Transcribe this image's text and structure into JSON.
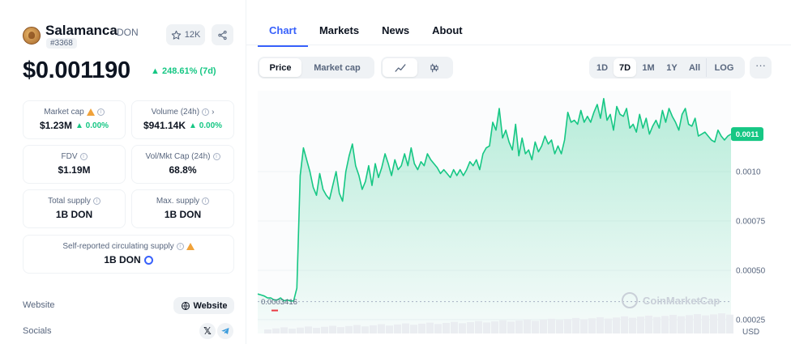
{
  "coin": {
    "name": "Salamanca",
    "symbol": "DON",
    "rank": "#3368",
    "watchlist_count": "12K",
    "price": "$0.001190",
    "price_change": "248.61% (7d)"
  },
  "stats": {
    "market_cap": {
      "label": "Market cap",
      "value": "$1.23M",
      "change": "0.00%"
    },
    "volume": {
      "label": "Volume (24h)",
      "value": "$941.14K",
      "change": "0.00%"
    },
    "fdv": {
      "label": "FDV",
      "value": "$1.19M"
    },
    "vol_mkt_cap": {
      "label": "Vol/Mkt Cap (24h)",
      "value": "68.8%"
    },
    "total_supply": {
      "label": "Total supply",
      "value": "1B DON"
    },
    "max_supply": {
      "label": "Max. supply",
      "value": "1B DON"
    },
    "circ_supply": {
      "label": "Self-reported circulating supply",
      "value": "1B DON"
    }
  },
  "links": {
    "website_label": "Website",
    "website_button": "Website",
    "socials_label": "Socials"
  },
  "tabs": [
    "Chart",
    "Markets",
    "News",
    "About"
  ],
  "chart_toggle": [
    "Price",
    "Market cap"
  ],
  "ranges": [
    "1D",
    "7D",
    "1M",
    "1Y",
    "All",
    "LOG"
  ],
  "active_range": "7D",
  "colors": {
    "positive": "#16c784",
    "accent": "#3861fb",
    "line": "#16c784",
    "marker_low": "#ea3943"
  },
  "chart_data": {
    "type": "area",
    "currency_label": "USD",
    "watermark": "CoinMarketCap",
    "current_price_label": "0.0011",
    "start_price_label": "0.0003416",
    "start_price": 0.0003416,
    "ylim": [
      0.00018,
      0.00141
    ],
    "ticks": [
      {
        "value": 0.001,
        "label": "0.0010"
      },
      {
        "value": 0.00075,
        "label": "0.00075"
      },
      {
        "value": 0.0005,
        "label": "0.00050"
      },
      {
        "value": 0.00025,
        "label": "0.00025"
      }
    ],
    "values": [
      0.00038,
      0.000375,
      0.00037,
      0.00036,
      0.00036,
      0.00035,
      0.00035,
      0.00036,
      0.000345,
      0.00035,
      0.000345,
      0.000345,
      0.00041,
      0.00098,
      0.00112,
      0.00106,
      0.001,
      0.00092,
      0.00088,
      0.00099,
      0.00091,
      0.00088,
      0.00086,
      0.00093,
      0.001,
      0.00089,
      0.00085,
      0.001,
      0.00108,
      0.00114,
      0.00103,
      0.00098,
      0.00091,
      0.00095,
      0.00103,
      0.00093,
      0.00104,
      0.00097,
      0.00102,
      0.00109,
      0.00104,
      0.00098,
      0.00106,
      0.00101,
      0.00103,
      0.00109,
      0.00103,
      0.00112,
      0.00104,
      0.00101,
      0.00105,
      0.00103,
      0.00109,
      0.00106,
      0.00104,
      0.00102,
      0.00099,
      0.00101,
      0.00099,
      0.00097,
      0.00101,
      0.00098,
      0.00101,
      0.00098,
      0.00101,
      0.00105,
      0.00103,
      0.00106,
      0.00101,
      0.00109,
      0.00112,
      0.00113,
      0.00125,
      0.00121,
      0.00132,
      0.00117,
      0.00121,
      0.00115,
      0.00111,
      0.00124,
      0.00108,
      0.00117,
      0.00109,
      0.00111,
      0.00106,
      0.00115,
      0.0011,
      0.00113,
      0.00118,
      0.00114,
      0.00116,
      0.00109,
      0.00113,
      0.00109,
      0.00116,
      0.0013,
      0.00125,
      0.00126,
      0.00124,
      0.00131,
      0.00125,
      0.00128,
      0.00125,
      0.0013,
      0.00134,
      0.00127,
      0.00137,
      0.00126,
      0.00129,
      0.00121,
      0.00133,
      0.00129,
      0.00128,
      0.00132,
      0.00122,
      0.00124,
      0.0012,
      0.00129,
      0.00122,
      0.00127,
      0.00119,
      0.00123,
      0.00126,
      0.00122,
      0.00131,
      0.00125,
      0.00132,
      0.00128,
      0.00125,
      0.00121,
      0.00129,
      0.00132,
      0.00124,
      0.00123,
      0.00127,
      0.00118,
      0.00119,
      0.0012,
      0.00118,
      0.00116,
      0.00115,
      0.00121,
      0.00118,
      0.00116,
      0.00118,
      0.00119
    ]
  }
}
